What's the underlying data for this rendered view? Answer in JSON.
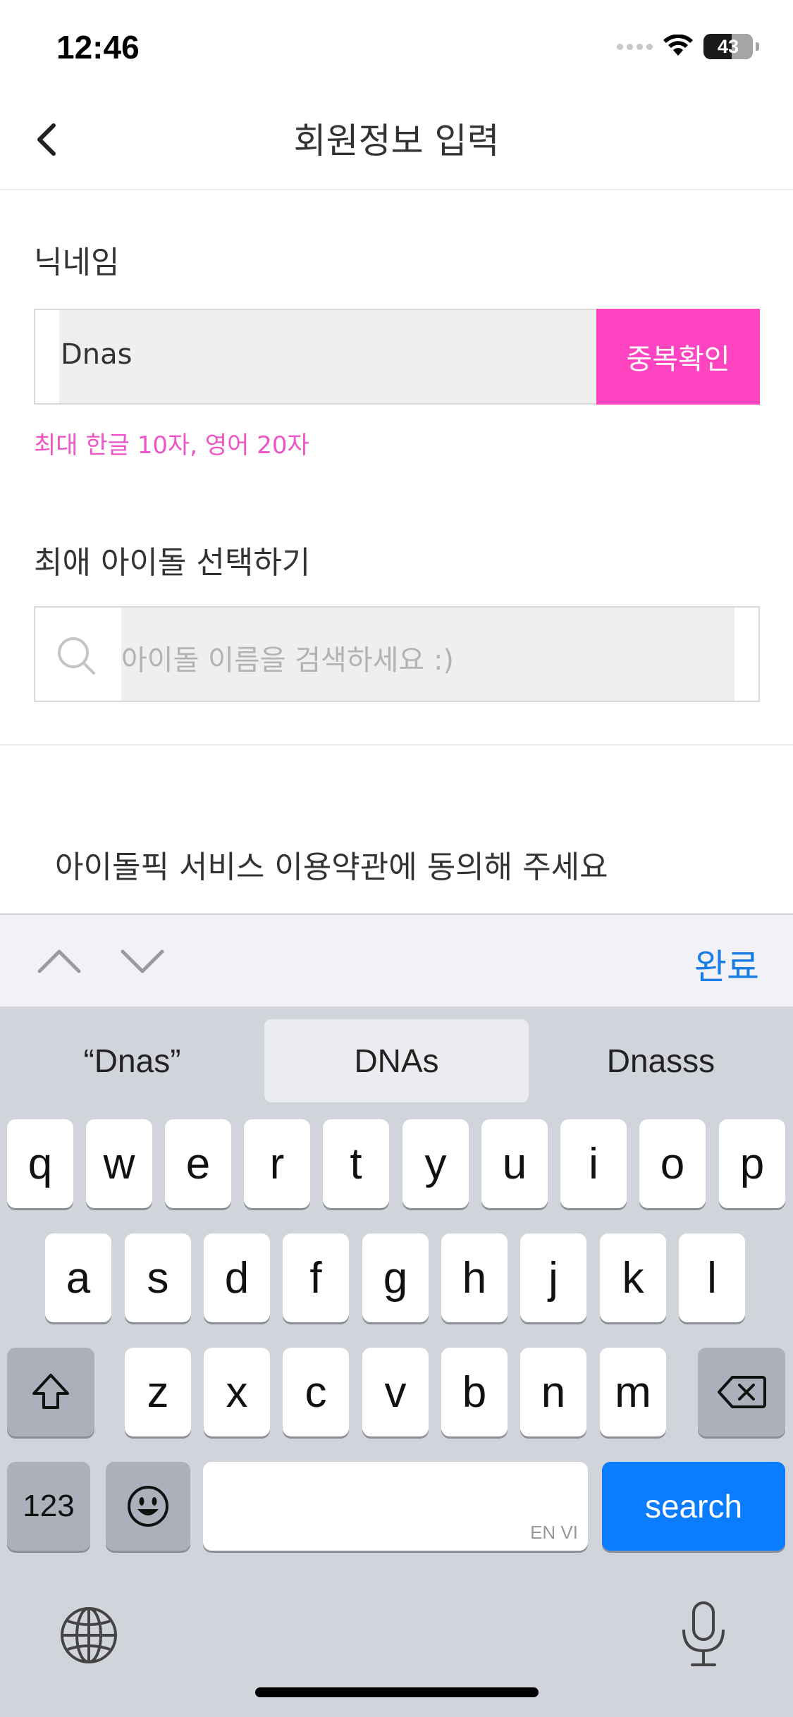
{
  "status": {
    "time": "12:46",
    "battery": "43"
  },
  "header": {
    "title": "회원정보 입력"
  },
  "nickname": {
    "label": "닉네임",
    "value": "Dnas",
    "check_button": "중복확인",
    "hint": "최대 한글 10자, 영어 20자"
  },
  "idol": {
    "label": "최애 아이돌 선택하기",
    "placeholder": "아이돌 이름을 검색하세요 :)"
  },
  "terms": {
    "text": "아이돌픽 서비스 이용약관에 동의해 주세요"
  },
  "accessory": {
    "done": "완료"
  },
  "keyboard": {
    "suggestions": [
      "“Dnas”",
      "DNAs",
      "Dnasss"
    ],
    "row1": [
      "q",
      "w",
      "e",
      "r",
      "t",
      "y",
      "u",
      "i",
      "o",
      "p"
    ],
    "row2": [
      "a",
      "s",
      "d",
      "f",
      "g",
      "h",
      "j",
      "k",
      "l"
    ],
    "row3": [
      "z",
      "x",
      "c",
      "v",
      "b",
      "n",
      "m"
    ],
    "numbers_key": "123",
    "search_key": "search",
    "space_hint": "EN VI"
  },
  "colors": {
    "accent_pink": "#ff44c2",
    "hint_pink": "#ee55c6",
    "ios_blue": "#0a7cff"
  }
}
